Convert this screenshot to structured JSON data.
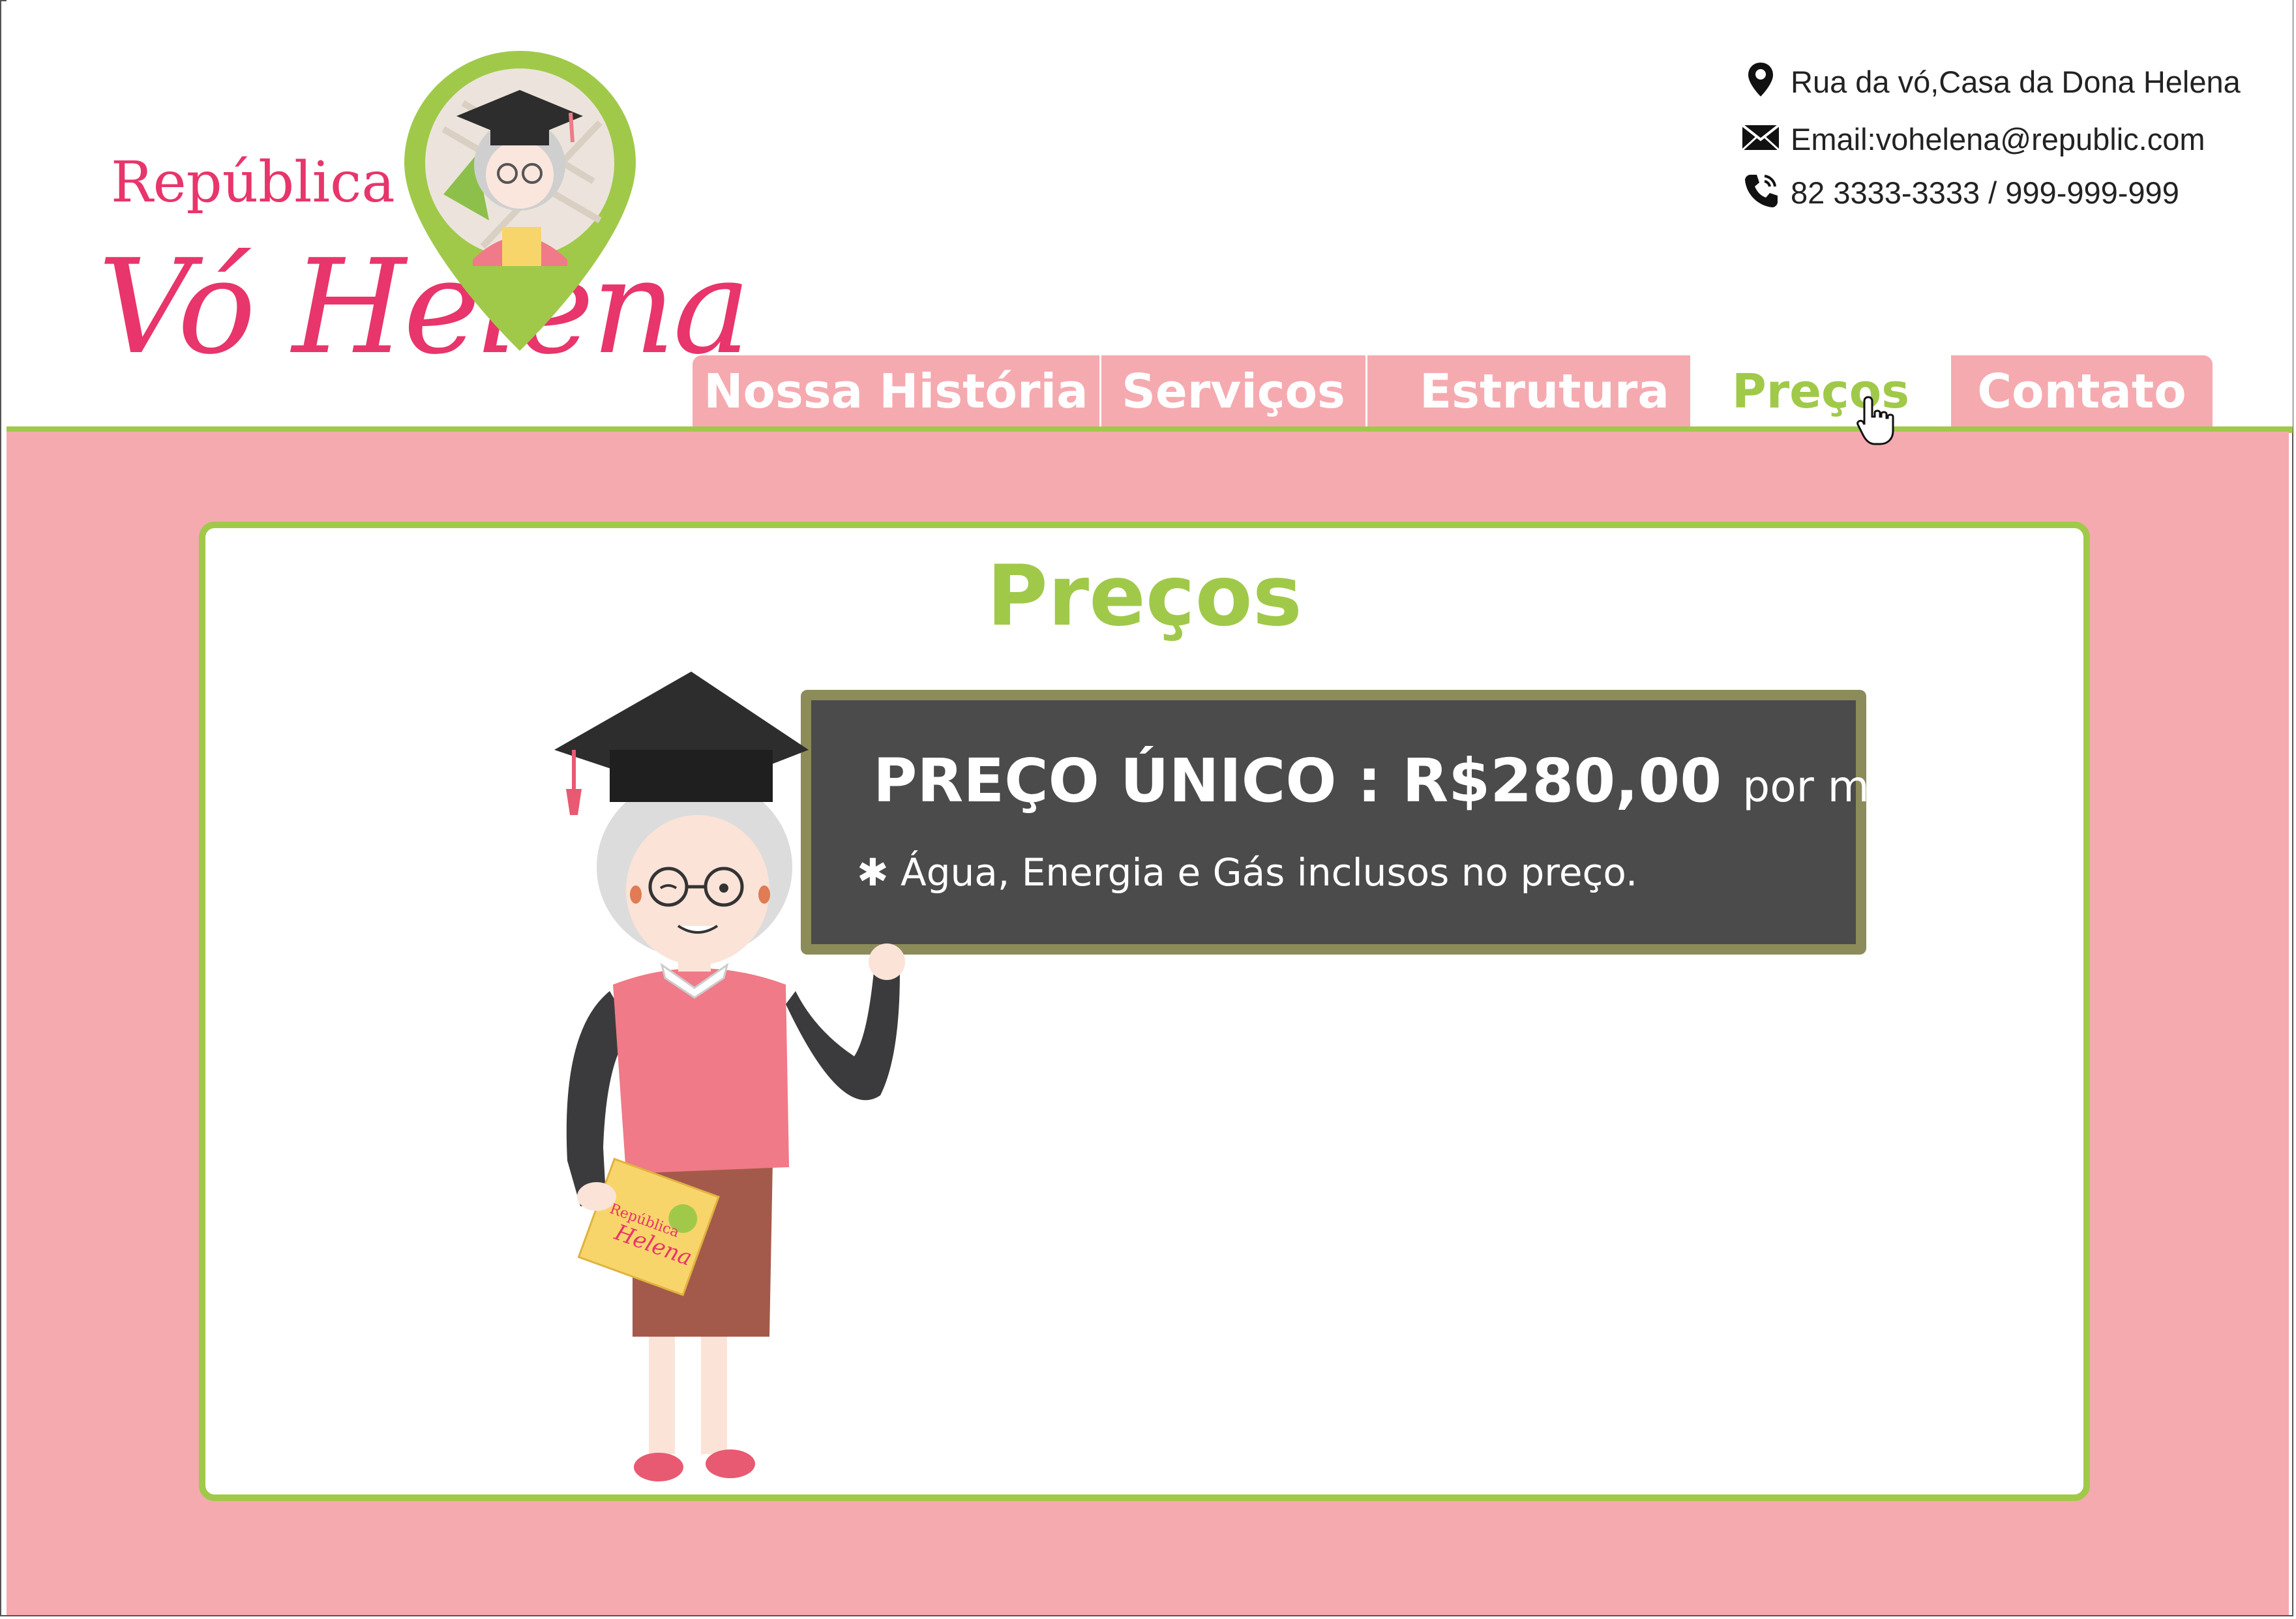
{
  "brand": {
    "line1": "República",
    "line2": "Vó Helena",
    "pin_icon": "map-pin-avatar-icon",
    "accent_pink": "#e8356b",
    "accent_green": "#a0c94a",
    "background_pink": "#f5aab0"
  },
  "contact": {
    "address": "Rua da vó,Casa da Dona Helena",
    "email": "Email:vohelena@republic.com",
    "phone": "82 3333-3333 / 999-999-999"
  },
  "nav": {
    "tabs": [
      {
        "label": "Nossa História",
        "active": false
      },
      {
        "label": "Serviços",
        "active": false
      },
      {
        "label": "Estrutura",
        "active": false
      },
      {
        "label": "Preços",
        "active": true
      },
      {
        "label": "Contato",
        "active": false
      }
    ]
  },
  "page": {
    "title": "Preços"
  },
  "board": {
    "main": "PREÇO ÚNICO : R$280,00",
    "sub": "por mês",
    "note": "Água, Energia e Gás inclusos no preço."
  },
  "book": {
    "line1": "República",
    "line2": "Helena"
  }
}
